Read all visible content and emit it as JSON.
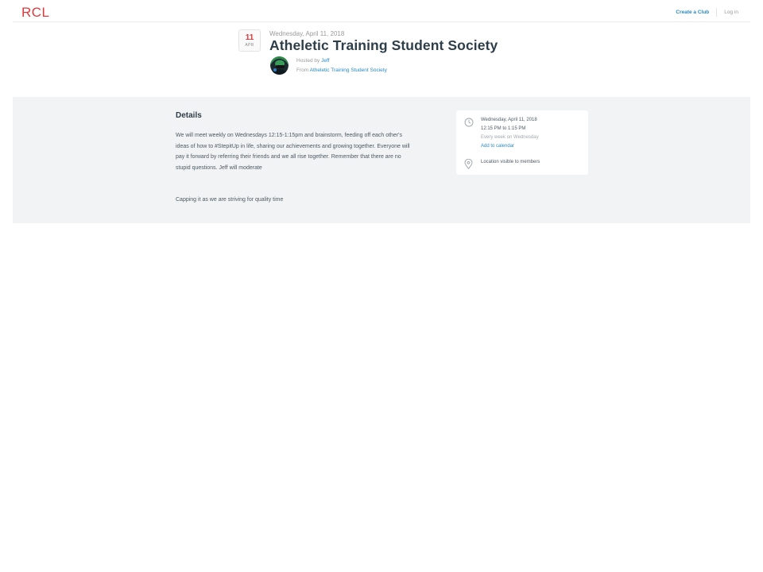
{
  "brand": {
    "logo": "RCL"
  },
  "nav": {
    "create_club": "Create a Club",
    "login": "Log in"
  },
  "event": {
    "day": "11",
    "month": "APR",
    "date_text": "Wednesday, April 11, 2018",
    "title": "Atheletic Training Student Society",
    "hosted_prefix": "Hosted by",
    "host": "Jeff",
    "from_prefix": "From",
    "group": "Atheletic Training Student Society"
  },
  "details": {
    "heading": "Details",
    "body": "We will meet weekly on Wednesdays 12:15-1:15pm and brainstorm, feeding off each other's ideas of how to #StepitUp in life, sharing our achievements and growing together. Everyone will pay it forward by referring their friends and we all rise together. Remember that there are no stupid questions. Jeff will moderate",
    "note": "Capping it as we are striving for quality time"
  },
  "info": {
    "date": "Wednesday, April 11, 2018",
    "time": "12:15 PM to 1:15 PM",
    "recurrence": "Every week on Wednesday",
    "add_calendar": "Add to calendar",
    "location": "Location visible to members"
  },
  "icons": {
    "time": "clock-icon",
    "location": "map-pin-icon"
  },
  "colors": {
    "brand": "#e0393e",
    "link": "#2a8ac6",
    "band": "#f2f3f4"
  }
}
